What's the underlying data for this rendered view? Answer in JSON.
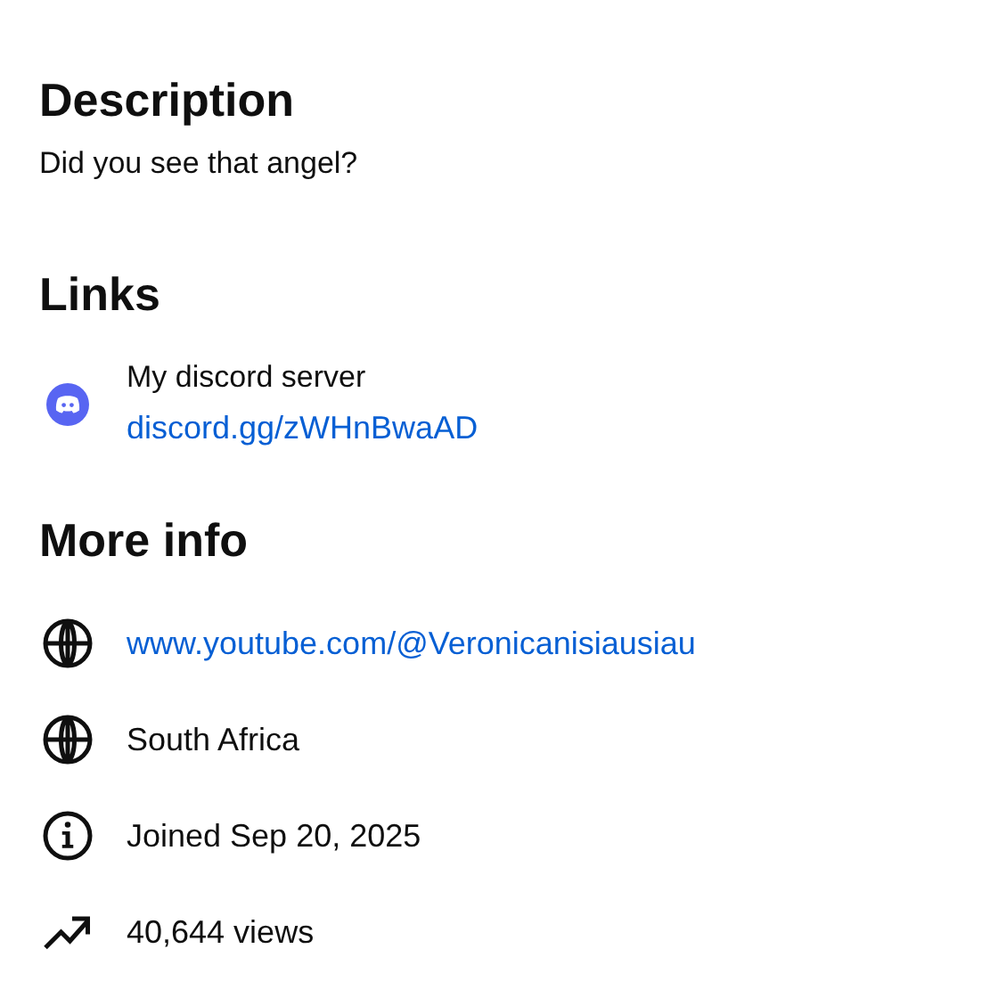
{
  "description": {
    "heading": "Description",
    "text": "Did you see that angel?"
  },
  "links": {
    "heading": "Links",
    "items": [
      {
        "title": "My discord server",
        "url": "discord.gg/zWHnBwaAD"
      }
    ]
  },
  "more_info": {
    "heading": "More info",
    "items": [
      {
        "kind": "website",
        "text": "www.youtube.com/@Veronicanisiausiau"
      },
      {
        "kind": "country",
        "text": "South Africa"
      },
      {
        "kind": "joined",
        "text": "Joined Sep 20, 2025"
      },
      {
        "kind": "views",
        "text": "40,644 views"
      }
    ]
  }
}
